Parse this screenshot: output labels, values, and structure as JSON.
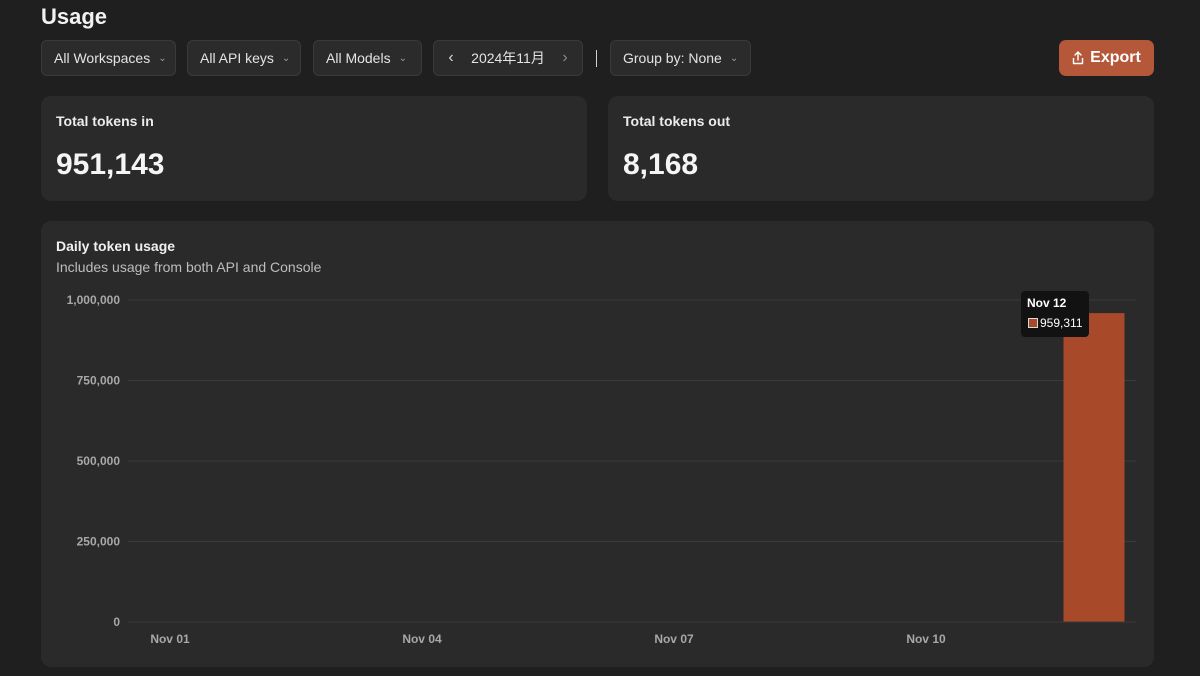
{
  "page": {
    "title": "Usage"
  },
  "toolbar": {
    "workspaces": "All Workspaces",
    "api_keys": "All API keys",
    "models": "All Models",
    "month": "2024年11月",
    "group_by": "Group by: None",
    "export": "Export"
  },
  "stats": {
    "tokens_in": {
      "label": "Total tokens in",
      "value": "951,143"
    },
    "tokens_out": {
      "label": "Total tokens out",
      "value": "8,168"
    }
  },
  "tooltip": {
    "date": "Nov 12",
    "value": "959,311"
  },
  "icons": {
    "dropdown": "chevron-down-icon",
    "prev": "chevron-left-icon",
    "next": "chevron-right-icon",
    "export": "share-export-icon"
  },
  "colors": {
    "accent": "#b5583a",
    "bar": "#a84a2a",
    "background": "#1f1f1f",
    "card": "#2a2a2a"
  },
  "chart_data": {
    "type": "bar",
    "title": "Daily token usage",
    "subtitle": "Includes usage from both API and Console",
    "categories": [
      "Nov 01",
      "Nov 02",
      "Nov 03",
      "Nov 04",
      "Nov 05",
      "Nov 06",
      "Nov 07",
      "Nov 08",
      "Nov 09",
      "Nov 10",
      "Nov 11",
      "Nov 12"
    ],
    "values": [
      0,
      0,
      0,
      0,
      0,
      0,
      0,
      0,
      0,
      0,
      0,
      959311
    ],
    "x_tick_labels": [
      "Nov 01",
      "Nov 04",
      "Nov 07",
      "Nov 10"
    ],
    "y_ticks": [
      0,
      250000,
      500000,
      750000,
      1000000
    ],
    "y_tick_labels": [
      "0",
      "250,000",
      "500,000",
      "750,000",
      "1,000,000"
    ],
    "ylim": [
      0,
      1000000
    ],
    "grid": true,
    "legend": "none",
    "xlabel": "",
    "ylabel": ""
  }
}
